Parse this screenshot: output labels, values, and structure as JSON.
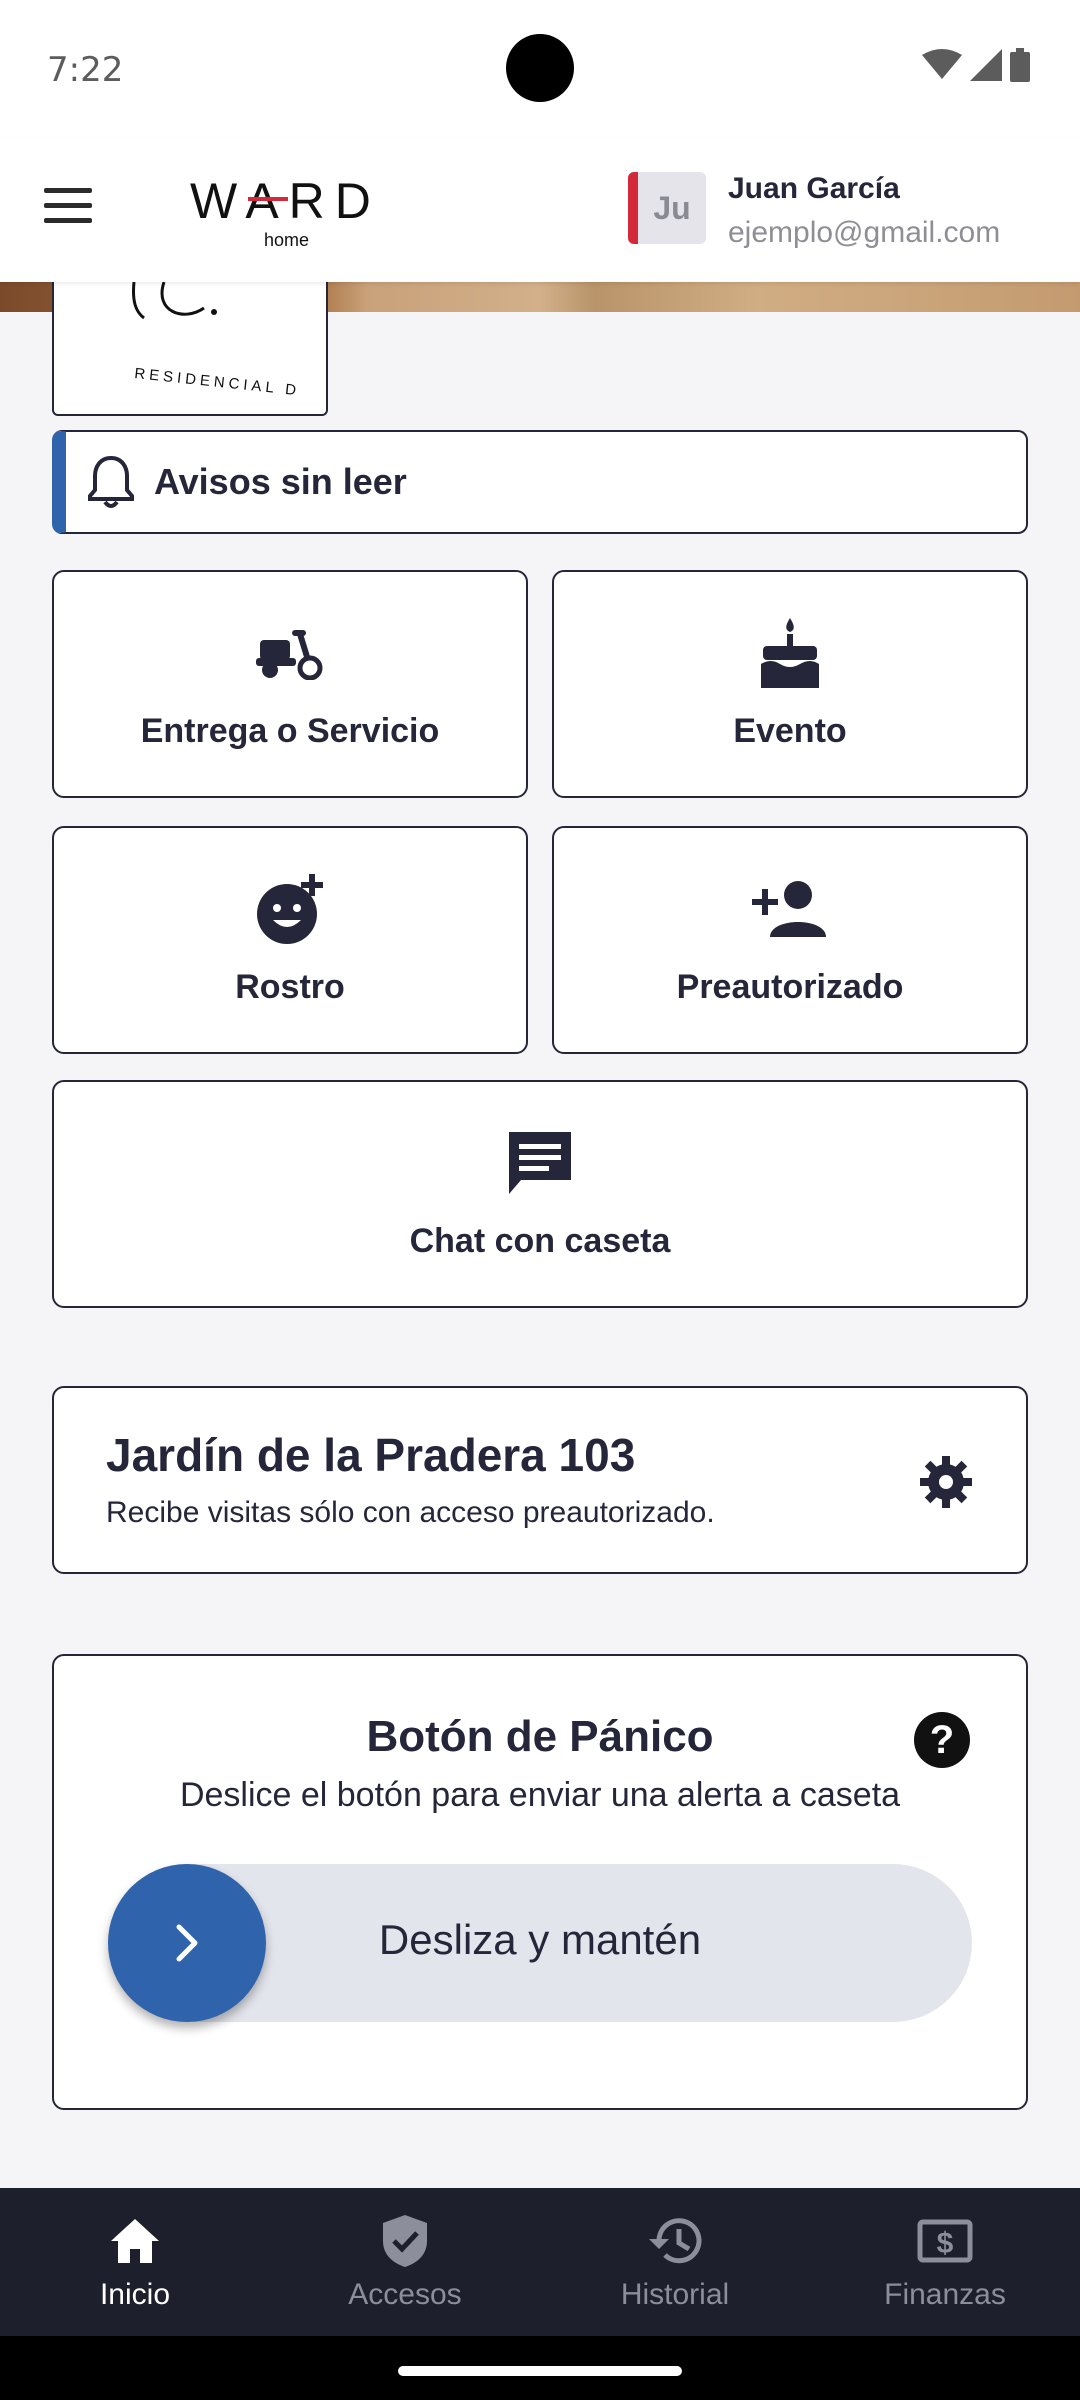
{
  "status_bar": {
    "time": "7:22"
  },
  "header": {
    "logo_text": "WARD",
    "logo_sub": "home",
    "avatar_initials": "Ju",
    "user_name": "Juan García",
    "user_email": "ejemplo@gmail.com"
  },
  "community_logo_text": "RESIDENCIAL D",
  "alerts": {
    "label": "Avisos sin leer"
  },
  "actions": {
    "delivery": "Entrega o Servicio",
    "event": "Evento",
    "face": "Rostro",
    "preauthorized": "Preautorizado",
    "chat": "Chat con caseta"
  },
  "residence": {
    "title": "Jardín de la Pradera 103",
    "subtitle": "Recibe visitas sólo con acceso preautorizado."
  },
  "panic": {
    "title": "Botón de Pánico",
    "help": "?",
    "subtitle": "Deslice el botón para enviar una alerta a caseta",
    "slider_label": "Desliza y mantén"
  },
  "nav": {
    "items": [
      {
        "label": "Inicio",
        "icon": "home-icon",
        "active": true
      },
      {
        "label": "Accesos",
        "icon": "shield-check-icon",
        "active": false
      },
      {
        "label": "Historial",
        "icon": "history-icon",
        "active": false
      },
      {
        "label": "Finanzas",
        "icon": "finance-icon",
        "active": false
      }
    ]
  },
  "colors": {
    "accent": "#2f64ad",
    "dark": "#25263a",
    "nav_bg": "#1e1f2d",
    "avatar_stripe": "#d22a3a"
  }
}
